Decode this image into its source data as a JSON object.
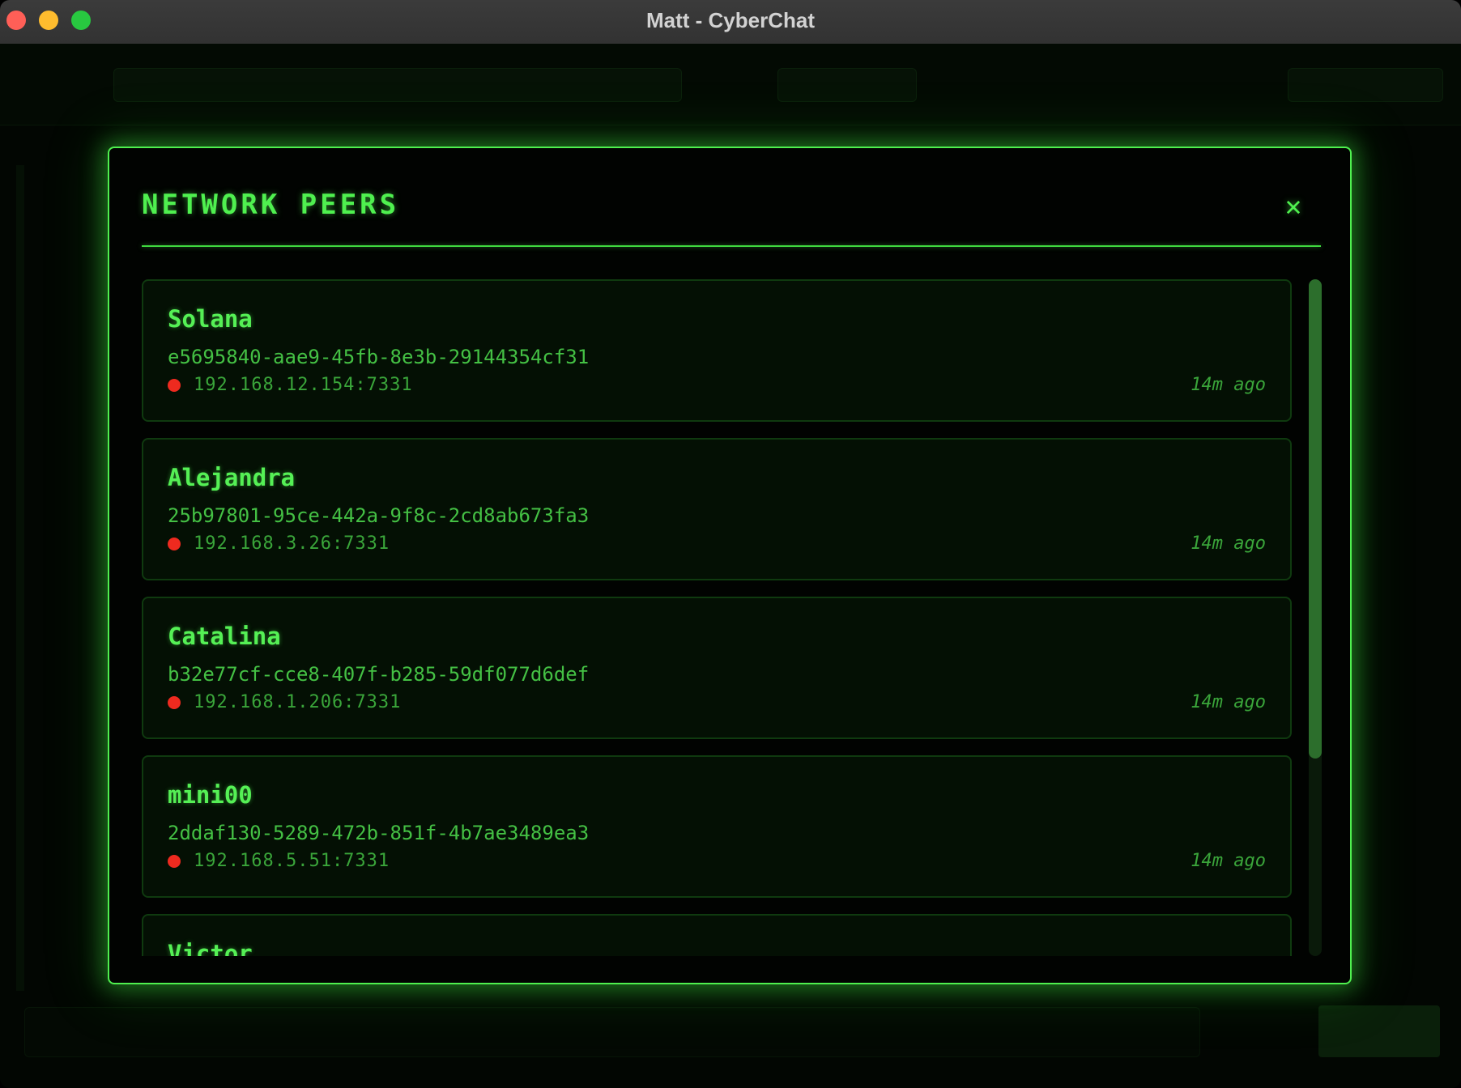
{
  "window": {
    "title": "Matt - CyberChat"
  },
  "modal": {
    "title": "NETWORK PEERS",
    "close_label": "✕"
  },
  "peers": [
    {
      "name": "Solana",
      "id": "e5695840-aae9-45fb-8e3b-29144354cf31",
      "address": "192.168.12.154:7331",
      "last_seen": "14m ago",
      "status": "offline"
    },
    {
      "name": "Alejandra",
      "id": "25b97801-95ce-442a-9f8c-2cd8ab673fa3",
      "address": "192.168.3.26:7331",
      "last_seen": "14m ago",
      "status": "offline"
    },
    {
      "name": "Catalina",
      "id": "b32e77cf-cce8-407f-b285-59df077d6def",
      "address": "192.168.1.206:7331",
      "last_seen": "14m ago",
      "status": "offline"
    },
    {
      "name": "mini00",
      "id": "2ddaf130-5289-472b-851f-4b7ae3489ea3",
      "address": "192.168.5.51:7331",
      "last_seen": "14m ago",
      "status": "offline"
    },
    {
      "name": "Victor",
      "id": "",
      "address": "",
      "last_seen": "",
      "status": "offline"
    }
  ],
  "colors": {
    "accent": "#4ff04f",
    "status_offline": "#ee2a1f"
  },
  "icons": {
    "close": "close-icon",
    "status": "status-dot-icon"
  }
}
